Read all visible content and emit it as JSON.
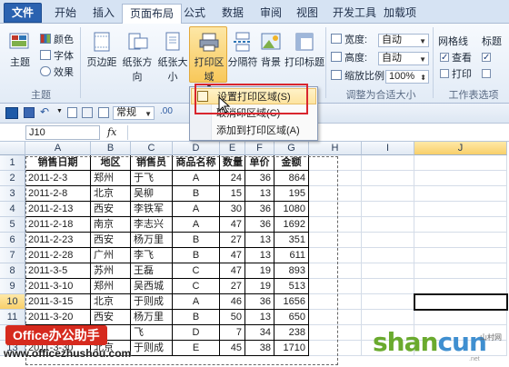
{
  "ribbon_tabs": [
    "文件",
    "开始",
    "插入",
    "页面布局",
    "公式",
    "数据",
    "审阅",
    "视图",
    "开发工具",
    "加载项"
  ],
  "theme_group": {
    "theme": "主题",
    "colors": "颜色",
    "fonts": "字体",
    "effects": "效果",
    "label": "主题"
  },
  "page_setup": {
    "margins": "页边距",
    "orientation": "纸张方向",
    "size": "纸张大小",
    "print_area": "打印区域",
    "breaks": "分隔符",
    "background": "背景",
    "print_titles": "打印标题"
  },
  "scale_group": {
    "width_label": "宽度:",
    "width_value": "自动",
    "height_label": "高度:",
    "height_value": "自动",
    "scale_label": "缩放比例:",
    "scale_value": "100%",
    "label": "调整为合适大小"
  },
  "sheet_options": {
    "gridlines": "网格线",
    "headings": "标题",
    "view": "查看",
    "print": "打印",
    "label": "工作表选项"
  },
  "print_area_menu": {
    "items": [
      "设置打印区域(S)",
      "取消印区域(C)",
      "添加到打印区域(A)"
    ]
  },
  "qat": {
    "style_value": "常规"
  },
  "formula_bar": {
    "name_box": "J10",
    "fx": "fx"
  },
  "columns": [
    "A",
    "B",
    "C",
    "D",
    "E",
    "F",
    "G",
    "H",
    "I",
    "J"
  ],
  "rows": [
    "1",
    "2",
    "3",
    "4",
    "5",
    "6",
    "7",
    "8",
    "9",
    "10",
    "11",
    "12",
    "13"
  ],
  "table": {
    "headers": [
      "销售日期",
      "地区",
      "销售员",
      "商品名称",
      "数量",
      "单价",
      "金额"
    ],
    "rows": [
      [
        "2011-2-3",
        "郑州",
        "于飞",
        "A",
        "24",
        "36",
        "864"
      ],
      [
        "2011-2-8",
        "北京",
        "吴柳",
        "B",
        "15",
        "13",
        "195"
      ],
      [
        "2011-2-13",
        "西安",
        "李铁军",
        "A",
        "30",
        "36",
        "1080"
      ],
      [
        "2011-2-18",
        "南京",
        "李志兴",
        "A",
        "47",
        "36",
        "1692"
      ],
      [
        "2011-2-23",
        "西安",
        "杨万里",
        "B",
        "27",
        "13",
        "351"
      ],
      [
        "2011-2-28",
        "广州",
        "李飞",
        "B",
        "47",
        "13",
        "611"
      ],
      [
        "2011-3-5",
        "苏州",
        "王磊",
        "C",
        "47",
        "19",
        "893"
      ],
      [
        "2011-3-10",
        "郑州",
        "吴西城",
        "C",
        "27",
        "19",
        "513"
      ],
      [
        "2011-3-15",
        "北京",
        "于则成",
        "A",
        "46",
        "36",
        "1656"
      ],
      [
        "2011-3-20",
        "西安",
        "杨万里",
        "B",
        "50",
        "13",
        "650"
      ],
      [
        "2011-3-25",
        "",
        "飞",
        "D",
        "7",
        "34",
        "238"
      ],
      [
        "2011-3-30",
        "北京",
        "于则成",
        "E",
        "45",
        "38",
        "1710"
      ]
    ]
  },
  "watermarks": {
    "badge": "Office办公助手",
    "url": "www.officezhushou.com",
    "logo_a": "shan",
    "logo_b": "cun",
    "logo_small": "山村网",
    "logo_net": ".net"
  },
  "colors": {
    "file_tab": "#2a62b0",
    "highlight": "#f8c85a",
    "callout": "#d9262e",
    "badge": "#d62a1e"
  }
}
